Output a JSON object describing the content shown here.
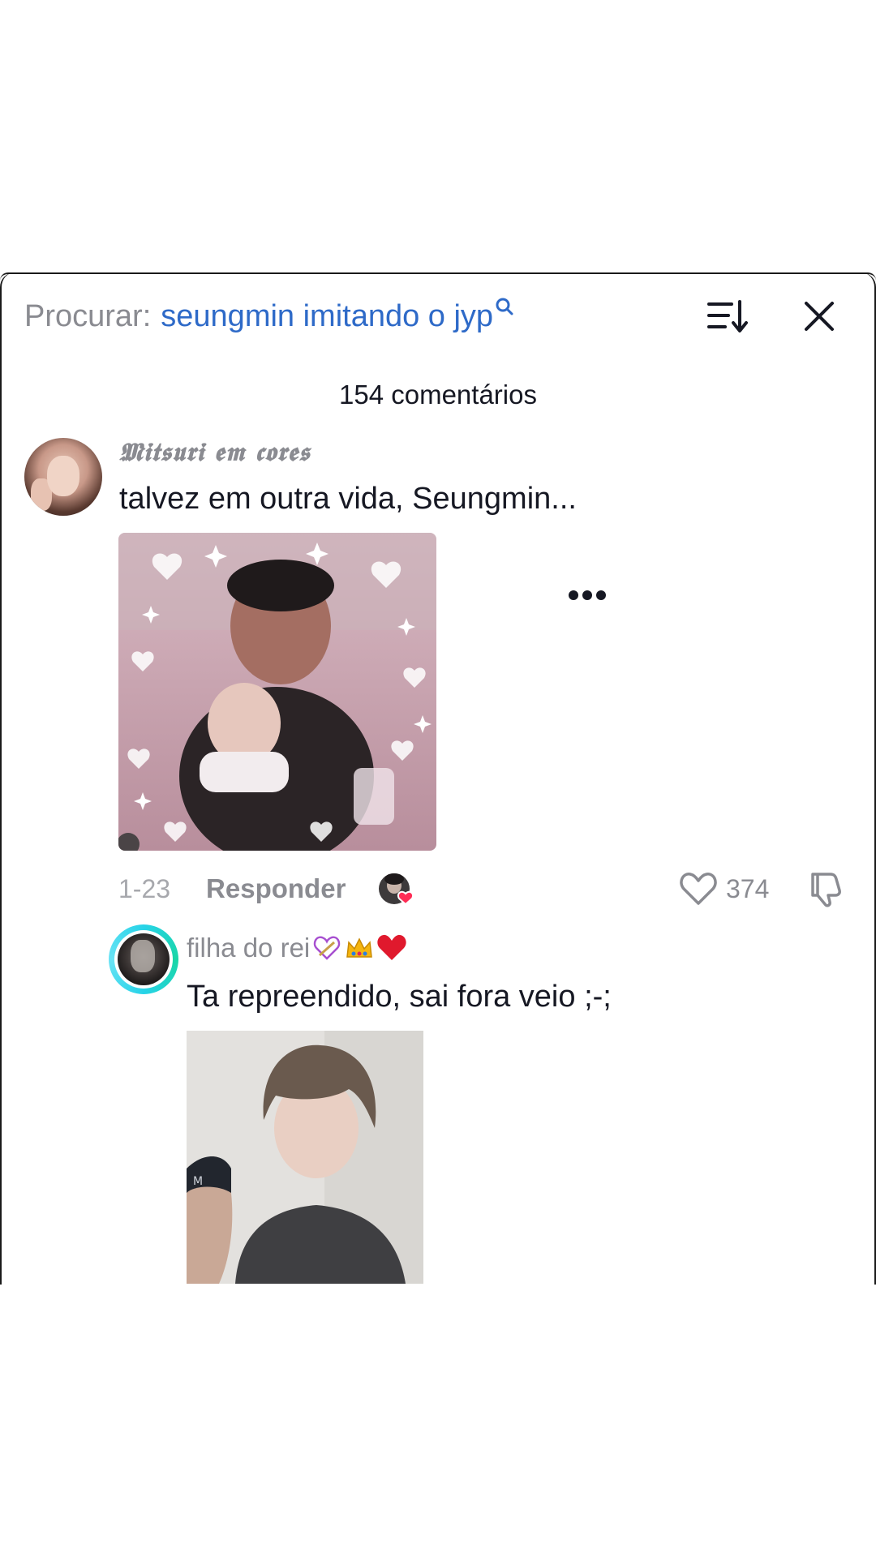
{
  "search": {
    "prefix": "Procurar:",
    "query": "seungmin imitando o jyp"
  },
  "comments_header": {
    "count_label": "154 comentários"
  },
  "comments": [
    {
      "username": "𝕸𝖎𝖙𝖘𝖚𝖗𝖎 𝖊𝖒 𝖈𝖔𝖗𝖊𝖘",
      "text": "talvez em outra vida, Seungmin...",
      "date": "1-23",
      "reply_label": "Responder",
      "like_count": "374"
    }
  ],
  "replies": [
    {
      "username": "filha do rei",
      "text": "Ta repreendido, sai fora veio ;-;"
    }
  ],
  "colors": {
    "accent_blue": "#2e6ac8",
    "muted_text": "#8a8b91",
    "heart_pink": "#fe2c55",
    "ring_cyan": "#27d3e8"
  },
  "icons": [
    "search-icon",
    "sort-icon",
    "close-icon",
    "more-icon",
    "heart-icon",
    "dislike-icon"
  ]
}
